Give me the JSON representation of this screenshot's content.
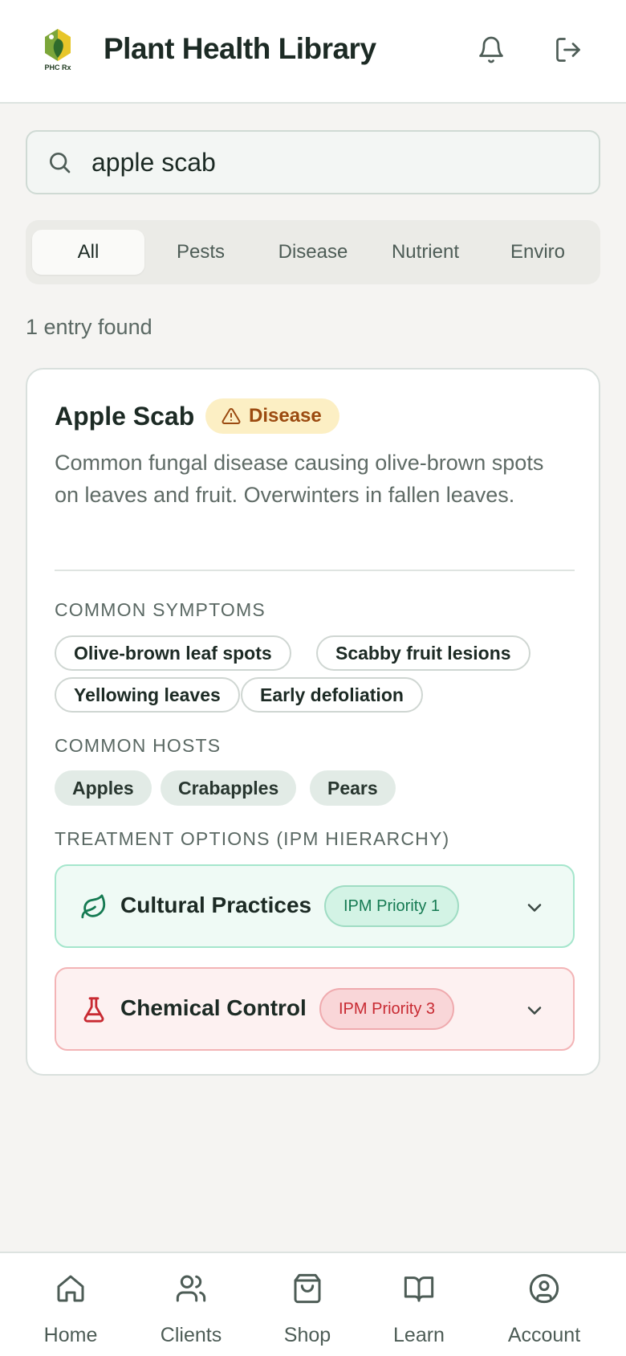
{
  "header": {
    "title": "Plant Health Library",
    "logo_text": "PHC Rx",
    "icons": [
      "bell-icon",
      "logout-icon"
    ]
  },
  "search": {
    "value": "apple scab",
    "placeholder": "Search"
  },
  "tabs": [
    {
      "label": "All",
      "active": true
    },
    {
      "label": "Pests",
      "active": false
    },
    {
      "label": "Disease",
      "active": false
    },
    {
      "label": "Nutrient",
      "active": false
    },
    {
      "label": "Enviro",
      "active": false
    }
  ],
  "results": {
    "count_text": "1 entry found"
  },
  "entry": {
    "title": "Apple Scab",
    "category": "Disease",
    "description": "Common fungal disease causing olive-brown spots on leaves and fruit. Overwinters in fallen leaves.",
    "symptoms_label": "COMMON SYMPTOMS",
    "symptoms": [
      "Olive-brown leaf spots",
      "Scabby fruit lesions",
      "Yellowing leaves",
      "Early defoliation"
    ],
    "hosts_label": "COMMON HOSTS",
    "hosts": [
      "Apples",
      "Crabapples",
      "Pears"
    ],
    "treatments_label": "TREATMENT OPTIONS (IPM HIERARCHY)",
    "treatments": [
      {
        "name": "Cultural Practices",
        "priority": "IPM Priority 1",
        "icon": "leaf-icon",
        "color": "#157a52"
      },
      {
        "name": "Chemical Control",
        "priority": "IPM Priority 3",
        "icon": "flask-icon",
        "color": "#c82a32"
      }
    ]
  },
  "bottom_nav": [
    {
      "label": "Home",
      "icon": "home-icon"
    },
    {
      "label": "Clients",
      "icon": "users-icon"
    },
    {
      "label": "Shop",
      "icon": "shopping-bag-icon"
    },
    {
      "label": "Learn",
      "icon": "book-icon"
    },
    {
      "label": "Account",
      "icon": "account-icon"
    }
  ],
  "colors": {
    "accent_green": "#157a52",
    "accent_red": "#c82a32",
    "disease_badge": "#9b4a10",
    "background": "#f5f4f2"
  }
}
